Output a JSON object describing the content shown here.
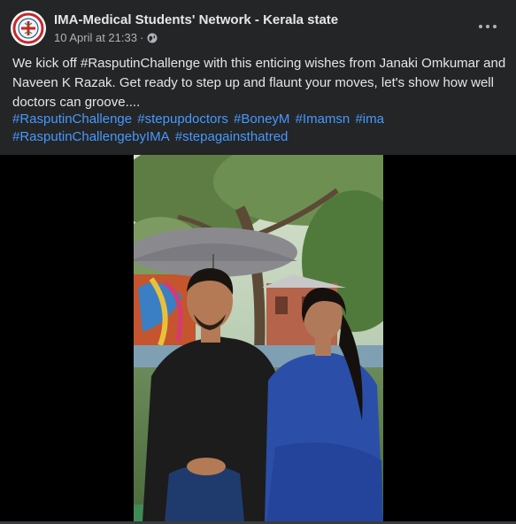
{
  "post": {
    "page_name": "IMA-Medical Students' Network - Kerala state",
    "date": "10 April at 21:33",
    "separator": "·",
    "privacy_icon": "globe-icon",
    "more_icon": "more-options-icon",
    "text": "We kick off #RasputinChallenge with this enticing wishes from Janaki Omkumar and Naveen K Razak. Get ready to step up and flaunt your moves, let's show how well doctors can groove....",
    "hashtags": [
      "#RasputinChallenge",
      "#stepupdoctors",
      "#BoneyM",
      "#Imamsn",
      "#ima",
      "#RasputinChallengebyIMA",
      "#stepagainsthatred"
    ]
  },
  "colors": {
    "background": "#242526",
    "text_primary": "#e4e6eb",
    "text_secondary": "#b0b3b8",
    "link": "#4599ff"
  }
}
